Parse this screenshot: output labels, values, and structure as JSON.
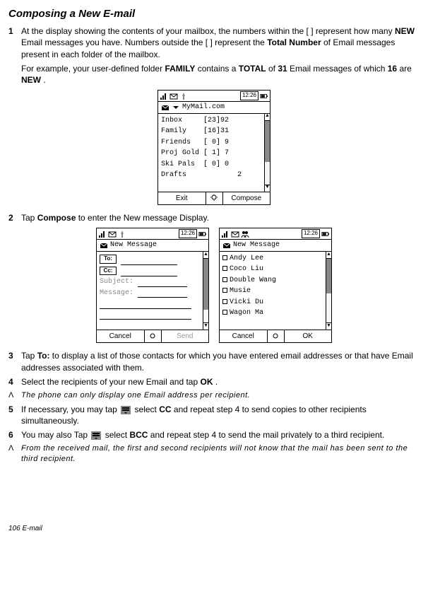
{
  "page_title": "Composing a New E-mail",
  "steps": {
    "s1": {
      "num": "1",
      "p1a": "At the display showing the contents of your mailbox, the numbers within the [ ] represent how many ",
      "p1b": "NEW",
      "p1c": " Email messages you have. Numbers outside the [ ] represent the ",
      "p1d": "Total Number",
      "p1e": " of Email messages present in each folder of the mailbox.",
      "p2a": "For example, your user-defined folder ",
      "p2b": "FAMILY",
      "p2c": " contains a ",
      "p2d": "TOTAL",
      "p2e": " of ",
      "p2f": "31",
      "p2g": " Email messages of which ",
      "p2h": "16",
      "p2i": " are ",
      "p2j": "NEW",
      "p2k": "."
    },
    "s2": {
      "num": "2",
      "t1": "Tap ",
      "t2": "Compose",
      "t3": " to enter the New message Display."
    },
    "s3": {
      "num": "3",
      "t1": "Tap ",
      "t2": "To:",
      "t3": " to display a list of those contacts for which you have entered email addresses or that have Email addresses associated with them."
    },
    "s4": {
      "num": "4",
      "t1": "Select the recipients of your new Email and tap ",
      "t2": "OK",
      "t3": "."
    },
    "s5": {
      "num": "5",
      "t1": "If necessary, you may tap ",
      "t2": " select ",
      "t3": "CC",
      "t4": " and repeat step 4 to send copies to other recipients simultaneously."
    },
    "s6": {
      "num": "6",
      "t1": "You may also Tap ",
      "t2": " select ",
      "t3": "BCC",
      "t4": " and repeat step 4 to send the mail privately to a third recipient."
    }
  },
  "notes": {
    "nA1": {
      "marker": "Λ",
      "text": "The phone can only display one Email address per recipient."
    },
    "nA2": {
      "marker": "Λ",
      "text": "From the received mail, the first and second recipients will not know that the mail has been sent to the third recipient."
    }
  },
  "phone1": {
    "time": "12:26",
    "title": "MyMail.com",
    "folders": [
      {
        "name": "Inbox",
        "new": "[23]",
        "total": "92"
      },
      {
        "name": "Family",
        "new": "[16]",
        "total": "31"
      },
      {
        "name": "Friends",
        "new": "[ 0]",
        "total": " 9"
      },
      {
        "name": "Proj Gold",
        "new": "[ 1]",
        "total": " 7"
      },
      {
        "name": "Ski Pals",
        "new": "[ 0]",
        "total": " 0"
      },
      {
        "name": "Drafts",
        "new": "    ",
        "total": " 2"
      }
    ],
    "soft_left": "Exit",
    "soft_right": "Compose"
  },
  "phone2": {
    "time": "12:26",
    "title": "New Message",
    "to_label": "To:",
    "cc_label": "Cc:",
    "subject_label": "Subject:",
    "message_label": "Message:",
    "soft_left": "Cancel",
    "soft_right": "Send"
  },
  "phone3": {
    "time": "12:26",
    "title": "New Message",
    "contacts": [
      "Andy Lee",
      "Coco Liu",
      "Double Wang",
      "Musie",
      "Vicki Du",
      "Wagon Ma"
    ],
    "soft_left": "Cancel",
    "soft_right": "OK"
  },
  "footer": "106   E-mail"
}
